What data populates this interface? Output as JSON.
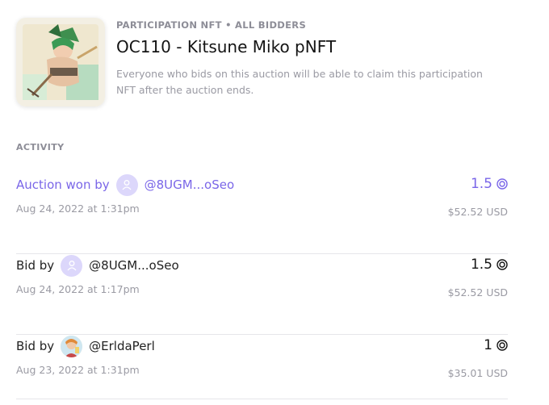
{
  "nft": {
    "overline": "PARTICIPATION NFT • ALL BIDDERS",
    "title": "OC110 - Kitsune Miko pNFT",
    "description": "Everyone who bids on this auction will be able to claim this participation NFT after the auction ends.",
    "image_icon": "nft-artwork-image"
  },
  "activity": {
    "heading": "ACTIVITY",
    "rows": [
      {
        "action": "Auction won by",
        "username": "@8UGM...oSeo",
        "avatar": "default-user-icon",
        "timestamp": "Aug 24, 2022 at 1:31pm",
        "amount": "1.5",
        "usd": "$52.52 USD",
        "highlight": true
      },
      {
        "action": "Bid by",
        "username": "@8UGM...oSeo",
        "avatar": "default-user-icon",
        "timestamp": "Aug 24, 2022 at 1:17pm",
        "amount": "1.5",
        "usd": "$52.52 USD",
        "highlight": false
      },
      {
        "action": "Bid by",
        "username": "@ErldaPerl",
        "avatar": "user-photo-avatar",
        "timestamp": "Aug 23, 2022 at 1:31pm",
        "amount": "1",
        "usd": "$35.01 USD",
        "highlight": false
      }
    ]
  },
  "colors": {
    "accent": "#7a66e8",
    "muted": "#9a9aa3",
    "text": "#141414",
    "divider": "#e6e6ea"
  }
}
